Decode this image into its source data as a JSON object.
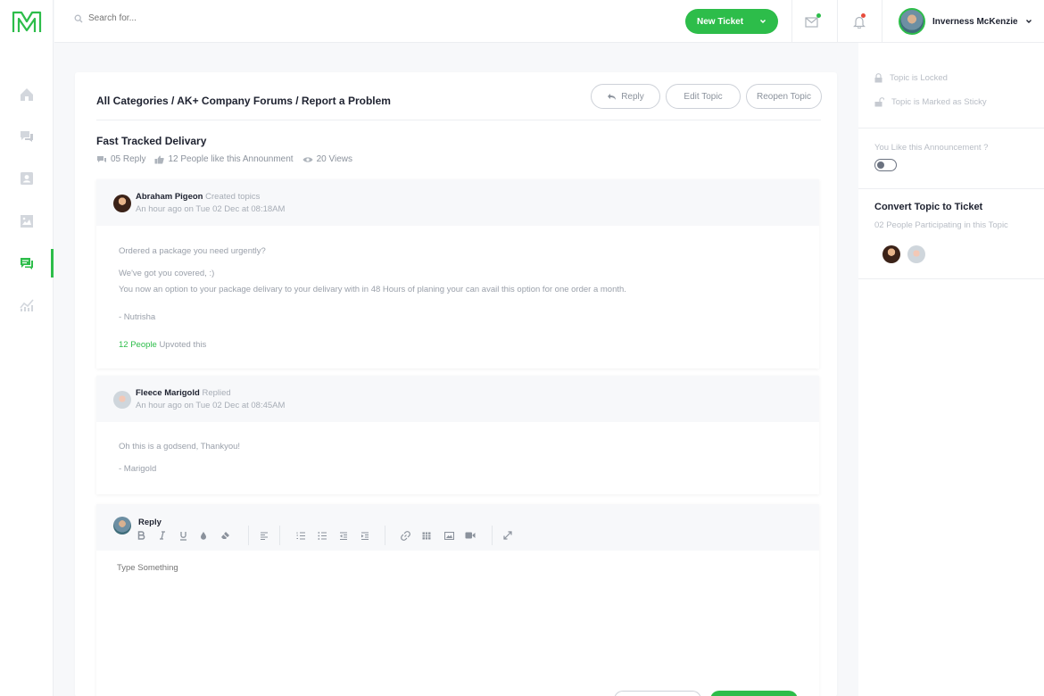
{
  "search": {
    "placeholder": "Search for..."
  },
  "header": {
    "new_ticket_label": "New Ticket",
    "user_name": "Inverness McKenzie"
  },
  "colors": {
    "accent": "#2dbd4a",
    "notification_dot": "#e74c3c"
  },
  "breadcrumb": "All Categories / AK+ Company Forums / Report a Problem",
  "actions": {
    "reply": "Reply",
    "edit": "Edit Topic",
    "reopen": "Reopen Topic"
  },
  "topic": {
    "title": "Fast Tracked Delivary",
    "replies": "05 Reply",
    "likes": "12 People like this Announment",
    "views": "20 Views"
  },
  "posts": [
    {
      "author": "Abraham Pigeon",
      "action": "Created topics",
      "time": "An hour ago on Tue 02 Dec at 08:18AM",
      "lines": [
        "Ordered a package you need urgently?",
        "We've got you covered, :)",
        "You now an option to your package delivary to your delivary with in 48 Hours of planing your can avail this option for one order a month.",
        "- Nutrisha"
      ],
      "upvote_count": "12 People",
      "upvote_text": "Upvoted this"
    },
    {
      "author": "Fleece Marigold",
      "action": "Replied",
      "time": "An hour ago on Tue 02 Dec at 08:45AM",
      "lines": [
        "Oh this is a godsend, Thankyou!",
        "- Marigold"
      ]
    }
  ],
  "editor": {
    "label": "Reply",
    "placeholder": "Type Something"
  },
  "sidebar_icons": [
    "home-icon",
    "messages-icon",
    "contacts-icon",
    "gallery-icon",
    "forum-icon",
    "reports-icon"
  ],
  "right_panel": {
    "locked": "Topic is Locked",
    "sticky": "Topic is Marked as Sticky",
    "like_question": "You Like this Announcement ?",
    "convert_title": "Convert Topic to Ticket",
    "participants": "02 People Participating in this Topic"
  }
}
